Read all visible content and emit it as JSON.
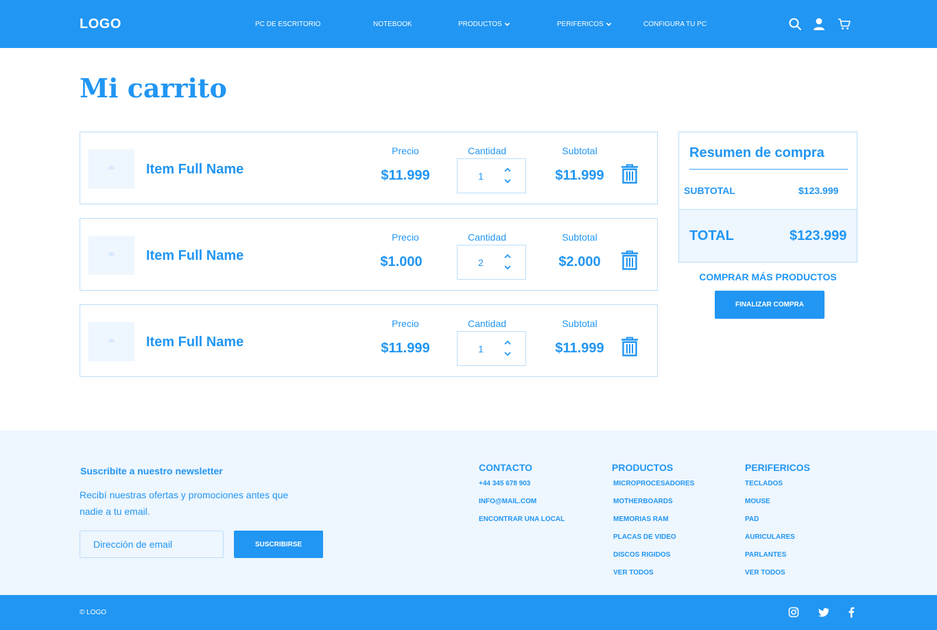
{
  "header": {
    "logo": "LOGO",
    "nav": [
      "PC DE ESCRITORIO",
      "NOTEBOOK",
      "PRODUCTOS",
      "PERIFERICOS",
      "CONFIGURA TU PC"
    ],
    "icons": [
      "search-icon",
      "user-icon",
      "cart-icon"
    ]
  },
  "page": {
    "title": "Mi carrito"
  },
  "cart": {
    "labels": {
      "price": "Precio",
      "quantity": "Cantidad",
      "subtotal": "Subtotal"
    },
    "items": [
      {
        "name": "Item Full Name",
        "price": "$11.999",
        "quantity": "1",
        "subtotal": "$11.999"
      },
      {
        "name": "Item Full Name",
        "price": "$1.000",
        "quantity": "2",
        "subtotal": "$2.000"
      },
      {
        "name": "Item Full Name",
        "price": "$11.999",
        "quantity": "1",
        "subtotal": "$11.999"
      }
    ]
  },
  "summary": {
    "title": "Resumen de compra",
    "subtotal_label": "SUBTOTAL",
    "subtotal_value": "$123.999",
    "total_label": "TOTAL",
    "total_value": "$123.999",
    "more_link": "COMPRAR MÁS PRODUCTOS",
    "checkout_button": "FINALIZAR COMPRA"
  },
  "footer": {
    "newsletter": {
      "title": "Suscribite a nuestro newsletter",
      "description": "Recibí nuestras ofertas y promociones antes que nadie a tu email.",
      "placeholder": "Dirección de email",
      "button": "SUSCRIBIRSE"
    },
    "contact": {
      "title": "CONTACTO",
      "links": [
        "+44 345 678 903",
        "INFO@MAIL.COM",
        "ENCONTRAR UNA LOCAL"
      ]
    },
    "products": {
      "title": "PRODUCTOS",
      "links": [
        "MICROPROCESADORES",
        "MOTHERBOARDS",
        "MEMORIAS RAM",
        "PLACAS DE VIDEO",
        "DISCOS RIGIDOS",
        "VER TODOS"
      ]
    },
    "peripherals": {
      "title": "PERIFERICOS",
      "links": [
        "TECLADOS",
        "MOUSE",
        "PAD",
        "AURICULARES",
        "PARLANTES",
        "VER TODOS"
      ]
    },
    "copyright": "© LOGO",
    "social": [
      "instagram-icon",
      "twitter-icon",
      "facebook-icon"
    ]
  },
  "colors": {
    "primary": "#2196F3",
    "light_bg": "#EEF6FE",
    "border": "#BBDEFB"
  }
}
